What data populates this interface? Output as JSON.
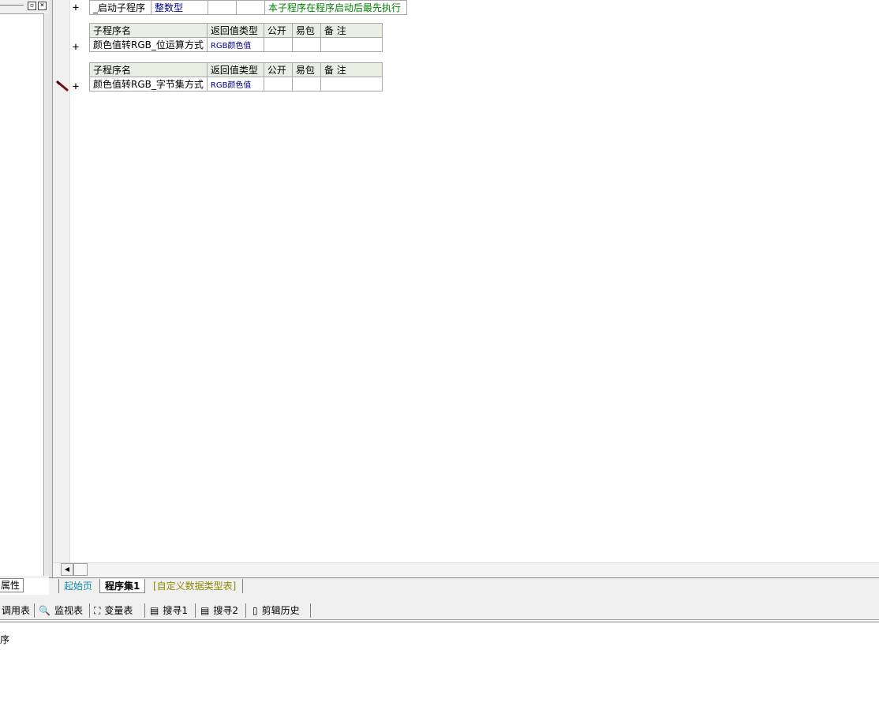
{
  "subroutines": [
    {
      "name": "_启动子程序",
      "return_type": "整数型",
      "public": "",
      "easy_pack": "",
      "note": "本子程序在程序启动后最先执行"
    },
    {
      "headers": {
        "name": "子程序名",
        "return_type": "返回值类型",
        "public": "公开",
        "easy_pack": "易包",
        "note": "备 注"
      },
      "name": "颜色值转RGB_位运算方式",
      "return_type": "RGB颜色值",
      "public": "",
      "easy_pack": "",
      "note": ""
    },
    {
      "headers": {
        "name": "子程序名",
        "return_type": "返回值类型",
        "public": "公开",
        "easy_pack": "易包",
        "note": "备 注"
      },
      "name": "颜色值转RGB_字节集方式",
      "return_type": "RGB颜色值",
      "public": "",
      "easy_pack": "",
      "note": ""
    }
  ],
  "gutter": {
    "expand_symbol": "+"
  },
  "left_panel": {
    "properties_tab": "属性"
  },
  "tabs": [
    {
      "label": "起始页"
    },
    {
      "label": "程序集1"
    },
    {
      "label": "[自定义数据类型表]"
    }
  ],
  "toolbar": {
    "call_table": "调用表",
    "watch_table": "监视表",
    "variable_table": "变量表",
    "search1": "搜寻1",
    "search2": "搜寻2",
    "clip_history": "剪辑历史"
  },
  "output": {
    "text": "序"
  },
  "colors": {
    "header_bg": "#e9eee3",
    "type_text": "#00008b",
    "note_text": "#008000",
    "tab_start": "#0f8fa8",
    "tab_custom": "#8a8a00"
  }
}
